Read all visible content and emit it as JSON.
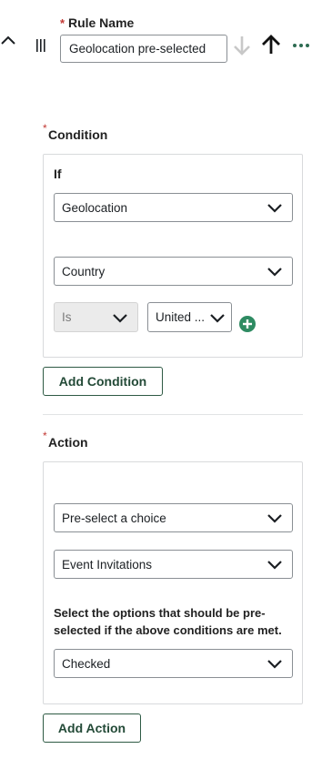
{
  "rule": {
    "required_marker": "*",
    "label": "Rule Name",
    "value": "Geolocation pre-selected"
  },
  "condition": {
    "required_marker": "*",
    "title": "Condition",
    "if_label": "If",
    "source_select": "Geolocation",
    "field_select": "Country",
    "operator_select": "Is",
    "value_select": "United ...",
    "add_condition_label": "Add Condition"
  },
  "action": {
    "required_marker": "*",
    "title": "Action",
    "action_select": "Pre-select a choice",
    "target_select": "Event Invitations",
    "helper_text": "Select the options that should be pre-selected if the above conditions are met.",
    "option_select": "Checked",
    "add_action_label": "Add Action"
  },
  "colors": {
    "required": "#c23934",
    "accent_green": "#2e8b62",
    "button_border": "#2e5a44"
  },
  "icons": {
    "collapse": "chevron-up-icon",
    "drag": "drag-handle-icon",
    "move_down": "arrow-down-icon",
    "move_up": "arrow-up-icon",
    "more": "more-horizontal-icon",
    "add": "plus-circle-icon",
    "dropdown": "chevron-down-icon"
  }
}
